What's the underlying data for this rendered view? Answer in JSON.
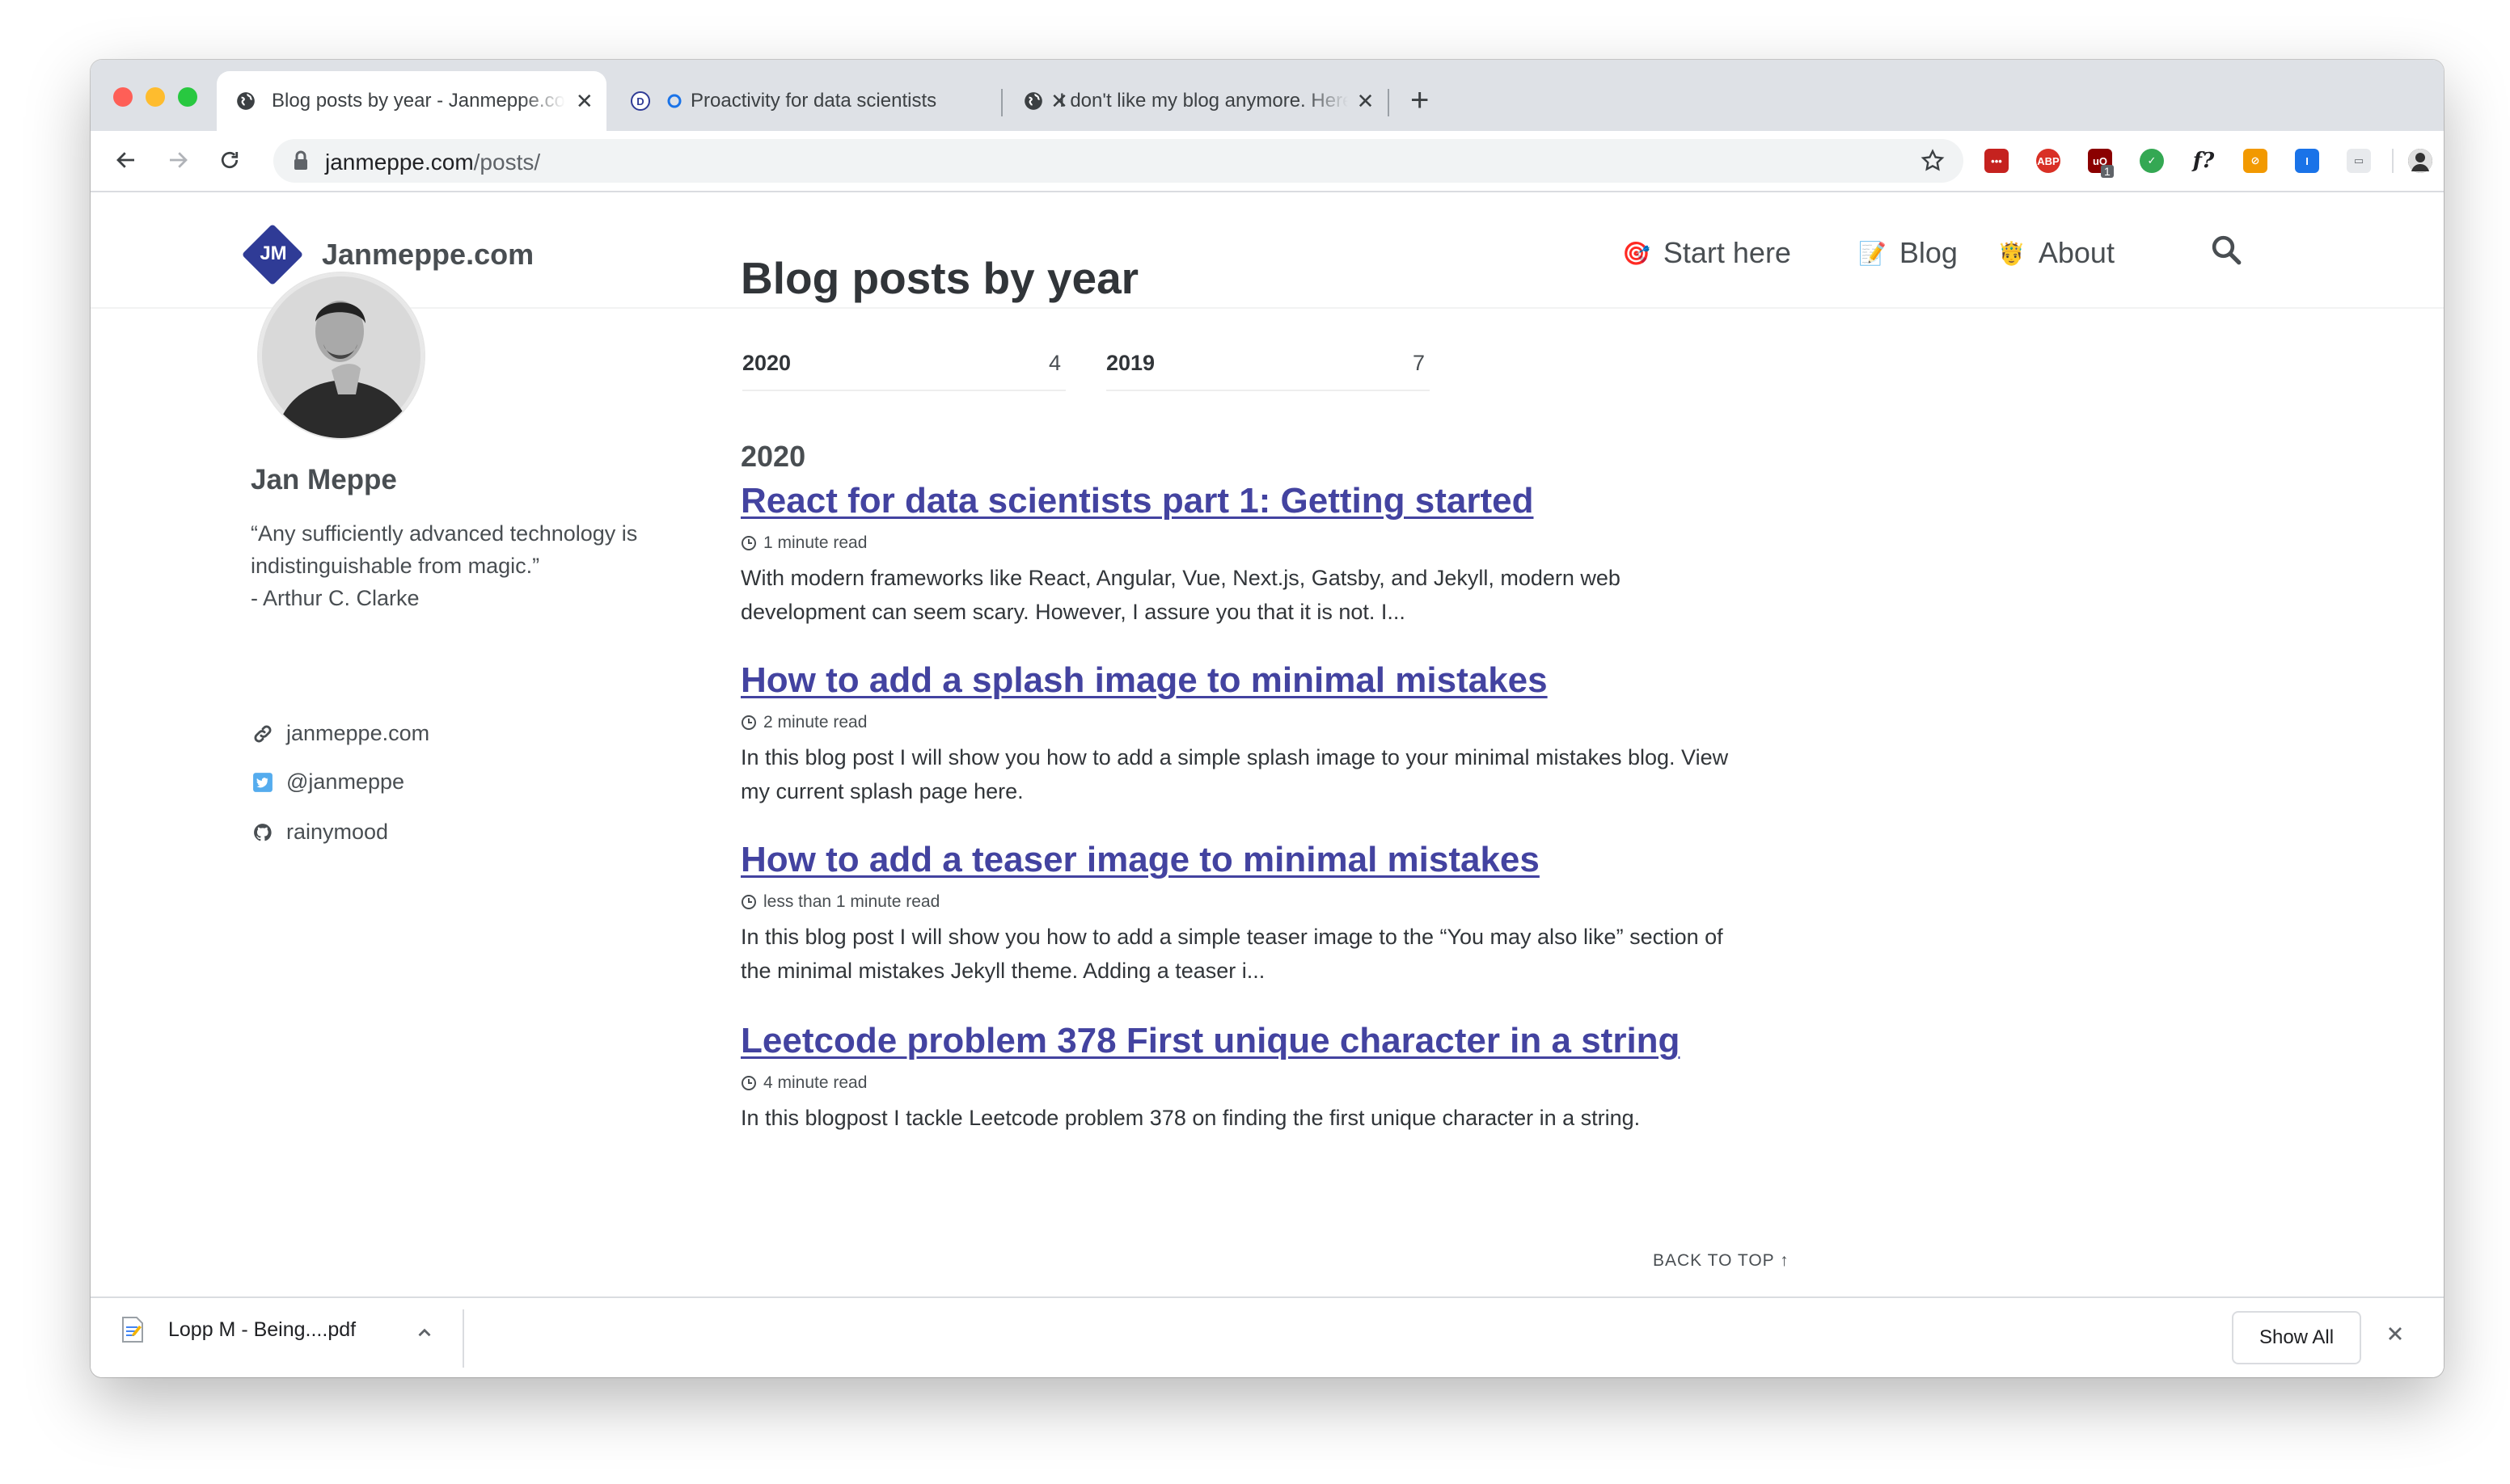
{
  "browser": {
    "tabs": [
      {
        "title": "Blog posts by year - Janmeppe.com",
        "active": true,
        "favicon": "globe-icon"
      },
      {
        "title": "Proactivity for data scientists",
        "active": false,
        "favicon": "d-icon"
      },
      {
        "title": "I don't like my blog anymore. Here is why",
        "active": false,
        "favicon": "globe-icon"
      }
    ],
    "url_domain": "janmeppe.com",
    "url_path": "/posts/",
    "extension_badge": "1"
  },
  "site": {
    "logo_initials": "JM",
    "title": "Janmeppe.com",
    "nav": [
      {
        "emoji": "🎯",
        "label": "Start here"
      },
      {
        "emoji": "📝",
        "label": "Blog"
      },
      {
        "emoji": "🤴",
        "label": "About"
      }
    ]
  },
  "author": {
    "name": "Jan Meppe",
    "bio_lines": [
      "“Any sufficiently advanced technology is",
      "indistinguishable from magic.”",
      "- Arthur C. Clarke"
    ],
    "links": [
      {
        "icon": "link-icon",
        "label": "janmeppe.com"
      },
      {
        "icon": "twitter-icon",
        "label": "@janmeppe"
      },
      {
        "icon": "github-icon",
        "label": "rainymood"
      }
    ]
  },
  "main": {
    "page_title": "Blog posts by year",
    "year_counts": [
      {
        "year": "2020",
        "count": "4"
      },
      {
        "year": "2019",
        "count": "7"
      }
    ],
    "year_heading": "2020",
    "posts": [
      {
        "title": "React for data scientists part 1: Getting started",
        "read_time": "1 minute read",
        "excerpt_lines": [
          "With modern frameworks like React, Angular, Vue, Next.js, Gatsby, and Jekyll, modern web",
          "development can seem scary. However, I assure you that it is not. I..."
        ]
      },
      {
        "title": "How to add a splash image to minimal mistakes",
        "read_time": "2 minute read",
        "excerpt_lines": [
          "In this blog post I will show you how to add a simple splash image to your minimal mistakes blog. View",
          "my current splash page here."
        ]
      },
      {
        "title": "How to add a teaser image to minimal mistakes",
        "read_time": "less than 1 minute read",
        "excerpt_lines": [
          "In this blog post I will show you how to add a simple teaser image to the “You may also like” section of",
          "the minimal mistakes Jekyll theme. Adding a teaser i..."
        ]
      },
      {
        "title": "Leetcode problem 378 First unique character in a string",
        "read_time": "4 minute read",
        "excerpt_lines": [
          "In this blogpost I tackle Leetcode problem 378 on finding the first unique character in a string."
        ]
      }
    ],
    "back_to_top": "BACK TO TOP ↑"
  },
  "downloads": {
    "file_name": "Lopp M - Being....pdf",
    "show_all": "Show All"
  },
  "colors": {
    "link": "#4343a0",
    "logo": "#2f3b96",
    "text": "#494e52",
    "tabstrip": "#dee1e6"
  }
}
